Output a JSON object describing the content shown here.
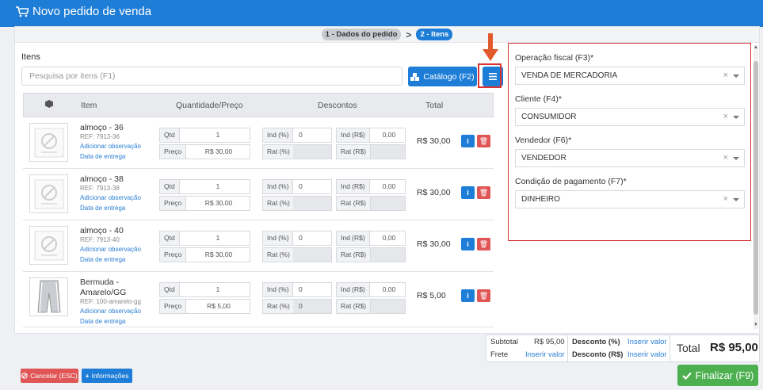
{
  "header": {
    "title": "Novo pedido de venda",
    "icon": "cart-icon"
  },
  "steps": [
    {
      "label": "1 - Dados do pedido"
    },
    {
      "label": "2 - Itens"
    }
  ],
  "items_section": {
    "label": "Itens",
    "search_placeholder": "Pesquisa por itens (F1)",
    "catalog_button": "Catálogo (F2)",
    "columns": {
      "item": "Item",
      "qty_price": "Quantidade/Preço",
      "discounts": "Descontos",
      "total": "Total"
    }
  },
  "rows": [
    {
      "name": "almoço - 36",
      "ref": "REF: 7913-36",
      "obs_link": "Adicionar observação",
      "date_link": "Data de entrega",
      "qtd_label": "Qtd",
      "qtd": "1",
      "price_label": "Preço",
      "price": "R$ 30,00",
      "ind_pct_label": "Ind (%)",
      "ind_pct": "0",
      "ind_rs_label": "Ind (R$)",
      "ind_rs": "0,00",
      "rat_pct_label": "Rat (%)",
      "rat_pct": "",
      "rat_rs_label": "Rat (R$)",
      "rat_rs": "",
      "total": "R$ 30,00"
    },
    {
      "name": "almoço - 38",
      "ref": "REF: 7913-38",
      "obs_link": "Adicionar observação",
      "date_link": "Data de entrega",
      "qtd_label": "Qtd",
      "qtd": "1",
      "price_label": "Preço",
      "price": "R$ 30,00",
      "ind_pct_label": "Ind (%)",
      "ind_pct": "0",
      "ind_rs_label": "Ind (R$)",
      "ind_rs": "0,00",
      "rat_pct_label": "Rat (%)",
      "rat_pct": "",
      "rat_rs_label": "Rat (R$)",
      "rat_rs": "",
      "total": "R$ 30,00"
    },
    {
      "name": "almoço - 40",
      "ref": "REF: 7913-40",
      "obs_link": "Adicionar observação",
      "date_link": "Data de entrega",
      "qtd_label": "Qtd",
      "qtd": "1",
      "price_label": "Preço",
      "price": "R$ 30,00",
      "ind_pct_label": "Ind (%)",
      "ind_pct": "0",
      "ind_rs_label": "Ind (R$)",
      "ind_rs": "0,00",
      "rat_pct_label": "Rat (%)",
      "rat_pct": "",
      "rat_rs_label": "Rat (R$)",
      "rat_rs": "",
      "total": "R$ 30,00"
    },
    {
      "name": "Bermuda - Amarelo/GG",
      "ref": "REF: 100-amarelo-gg",
      "obs_link": "Adicionar observação",
      "date_link": "Data de entrega",
      "qtd_label": "Qtd",
      "qtd": "1",
      "price_label": "Preço",
      "price": "R$ 5,00",
      "ind_pct_label": "Ind (%)",
      "ind_pct": "0",
      "ind_rs_label": "Ind (R$)",
      "ind_rs": "0,00",
      "rat_pct_label": "Rat (%)",
      "rat_pct": "0",
      "rat_rs_label": "Rat (R$)",
      "rat_rs": "",
      "total": "R$ 5,00"
    }
  ],
  "order_fields": {
    "fiscal_label": "Operação fiscal (F3)*",
    "fiscal_value": "VENDA DE MERCADORIA",
    "client_label": "Cliente (F4)*",
    "client_value": "CONSUMIDOR",
    "seller_label": "Vendedor (F6)*",
    "seller_value": "VENDEDOR",
    "payment_label": "Condição de pagamento (F7)*",
    "payment_value": "DINHEIRO",
    "clear_symbol": "×"
  },
  "summary": {
    "subtotal_label": "Subtotal",
    "subtotal": "R$ 95,00",
    "freight_label": "Frete",
    "freight_link": "Inserir valor",
    "disc_pct_label": "Desconto (%)",
    "disc_pct_link": "Inserir valor",
    "disc_rs_label": "Desconto (R$)",
    "disc_rs_link": "Inserir valor",
    "total_label": "Total",
    "total": "R$ 95,00"
  },
  "footer": {
    "cancel": "Cancelar (ESC)",
    "info": "Informações",
    "finish": "Finalizar (F9)"
  },
  "colors": {
    "primary": "#1e7dd6",
    "danger": "#e05555",
    "success": "#4caf50",
    "highlight": "#d93333"
  }
}
